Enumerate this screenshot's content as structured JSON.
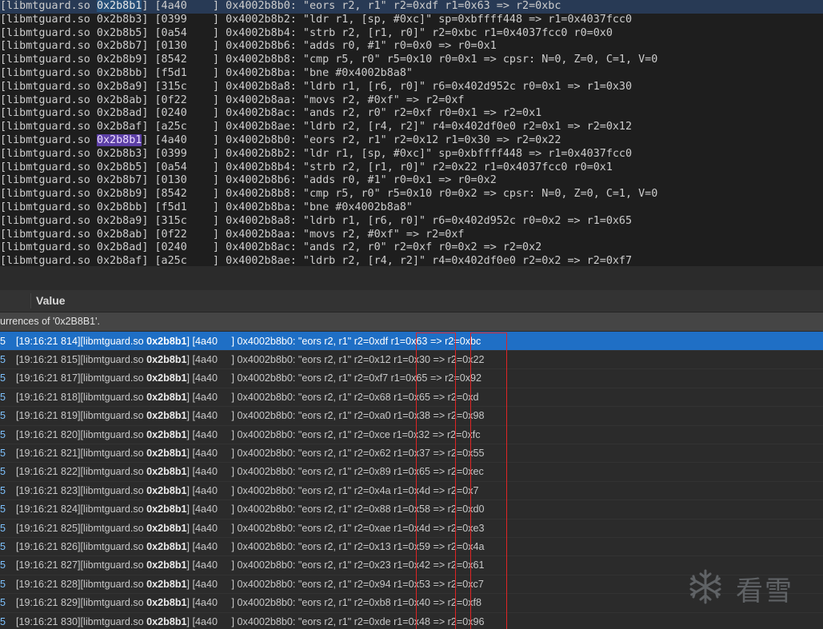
{
  "trace": {
    "lines": [
      {
        "a": "[libmtguard.so ",
        "h": "0x2b8b1",
        "hl": "first",
        "b": "] [4a40    ] 0x4002b8b0: \"eors r2, r1\" r2=0xdf r1=0x63 => r2=0xbc"
      },
      {
        "a": "[libmtguard.so 0x2b8b3] [0399    ] 0x4002b8b2: \"ldr r1, [sp, #0xc]\" sp=0xbffff448 => r1=0x4037fcc0"
      },
      {
        "a": "[libmtguard.so 0x2b8b5] [0a54    ] 0x4002b8b4: \"strb r2, [r1, r0]\" r2=0xbc r1=0x4037fcc0 r0=0x0"
      },
      {
        "a": "[libmtguard.so 0x2b8b7] [0130    ] 0x4002b8b6: \"adds r0, #1\" r0=0x0 => r0=0x1"
      },
      {
        "a": "[libmtguard.so 0x2b8b9] [8542    ] 0x4002b8b8: \"cmp r5, r0\" r5=0x10 r0=0x1 => cpsr: N=0, Z=0, C=1, V=0"
      },
      {
        "a": "[libmtguard.so 0x2b8bb] [f5d1    ] 0x4002b8ba: \"bne #0x4002b8a8\""
      },
      {
        "a": "[libmtguard.so 0x2b8a9] [315c    ] 0x4002b8a8: \"ldrb r1, [r6, r0]\" r6=0x402d952c r0=0x1 => r1=0x30"
      },
      {
        "a": "[libmtguard.so 0x2b8ab] [0f22    ] 0x4002b8aa: \"movs r2, #0xf\" => r2=0xf"
      },
      {
        "a": "[libmtguard.so 0x2b8ad] [0240    ] 0x4002b8ac: \"ands r2, r0\" r2=0xf r0=0x1 => r2=0x1"
      },
      {
        "a": "[libmtguard.so 0x2b8af] [a25c    ] 0x4002b8ae: \"ldrb r2, [r4, r2]\" r4=0x402df0e0 r2=0x1 => r2=0x12"
      },
      {
        "a": "[libmtguard.so ",
        "h": "0x2b8b1",
        "hl": "second",
        "b": "] [4a40    ] 0x4002b8b0: \"eors r2, r1\" r2=0x12 r1=0x30 => r2=0x22"
      },
      {
        "a": "[libmtguard.so 0x2b8b3] [0399    ] 0x4002b8b2: \"ldr r1, [sp, #0xc]\" sp=0xbffff448 => r1=0x4037fcc0"
      },
      {
        "a": "[libmtguard.so 0x2b8b5] [0a54    ] 0x4002b8b4: \"strb r2, [r1, r0]\" r2=0x22 r1=0x4037fcc0 r0=0x1"
      },
      {
        "a": "[libmtguard.so 0x2b8b7] [0130    ] 0x4002b8b6: \"adds r0, #1\" r0=0x1 => r0=0x2"
      },
      {
        "a": "[libmtguard.so 0x2b8b9] [8542    ] 0x4002b8b8: \"cmp r5, r0\" r5=0x10 r0=0x2 => cpsr: N=0, Z=0, C=1, V=0"
      },
      {
        "a": "[libmtguard.so 0x2b8bb] [f5d1    ] 0x4002b8ba: \"bne #0x4002b8a8\""
      },
      {
        "a": "[libmtguard.so 0x2b8a9] [315c    ] 0x4002b8a8: \"ldrb r1, [r6, r0]\" r6=0x402d952c r0=0x2 => r1=0x65"
      },
      {
        "a": "[libmtguard.so 0x2b8ab] [0f22    ] 0x4002b8aa: \"movs r2, #0xf\" => r2=0xf"
      },
      {
        "a": "[libmtguard.so 0x2b8ad] [0240    ] 0x4002b8ac: \"ands r2, r0\" r2=0xf r0=0x2 => r2=0x2"
      },
      {
        "a": "[libmtguard.so 0x2b8af] [a25c    ] 0x4002b8ae: \"ldrb r2, [r4, r2]\" r4=0x402df0e0 r2=0x2 => r2=0xf7"
      }
    ]
  },
  "results": {
    "column_value": "Value",
    "summary": "urrences of '0x2B8B1'.",
    "row_number_prefix": "5",
    "rows": [
      {
        "ts": "[19:16:21 814]",
        "r2": "0xdf",
        "r1": "0x63",
        "out": "0xbc",
        "selected": true
      },
      {
        "ts": "[19:16:21 815]",
        "r2": "0x12",
        "r1": "0x30",
        "out": "0x22"
      },
      {
        "ts": "[19:16:21 817]",
        "r2": "0xf7",
        "r1": "0x65",
        "out": "0x92"
      },
      {
        "ts": "[19:16:21 818]",
        "r2": "0x68",
        "r1": "0x65",
        "out": "0xd"
      },
      {
        "ts": "[19:16:21 819]",
        "r2": "0xa0",
        "r1": "0x38",
        "out": "0x98"
      },
      {
        "ts": "[19:16:21 820]",
        "r2": "0xce",
        "r1": "0x32",
        "out": "0xfc"
      },
      {
        "ts": "[19:16:21 821]",
        "r2": "0x62",
        "r1": "0x37",
        "out": "0x55"
      },
      {
        "ts": "[19:16:21 822]",
        "r2": "0x89",
        "r1": "0x65",
        "out": "0xec"
      },
      {
        "ts": "[19:16:21 823]",
        "r2": "0x4a",
        "r1": "0x4d",
        "out": "0x7"
      },
      {
        "ts": "[19:16:21 824]",
        "r2": "0x88",
        "r1": "0x58",
        "out": "0xd0"
      },
      {
        "ts": "[19:16:21 825]",
        "r2": "0xae",
        "r1": "0x4d",
        "out": "0xe3"
      },
      {
        "ts": "[19:16:21 826]",
        "r2": "0x13",
        "r1": "0x59",
        "out": "0x4a"
      },
      {
        "ts": "[19:16:21 827]",
        "r2": "0x23",
        "r1": "0x42",
        "out": "0x61"
      },
      {
        "ts": "[19:16:21 828]",
        "r2": "0x94",
        "r1": "0x53",
        "out": "0xc7"
      },
      {
        "ts": "[19:16:21 829]",
        "r2": "0xb8",
        "r1": "0x40",
        "out": "0xf8"
      },
      {
        "ts": "[19:16:21 830]",
        "r2": "0xde",
        "r1": "0x48",
        "out": "0x96"
      }
    ],
    "row_parts": {
      "lib": "[libmtguard.so ",
      "addr": "0x2b8b1",
      "mid": "] [4a40     ] 0x4002b8b0: \"eors r2, r1\" ",
      "r2_prefix": "r2=",
      "r1_prefix": " r1=",
      "arrow": " => r2="
    }
  },
  "watermark": {
    "text": "看雪",
    "icon": "snowflake-icon"
  },
  "colors": {
    "selection_blue": "#1f6fc5",
    "annotation_red": "#e02424",
    "first_match_highlight": "#264f78",
    "second_match_highlight": "#5c3fa6"
  }
}
